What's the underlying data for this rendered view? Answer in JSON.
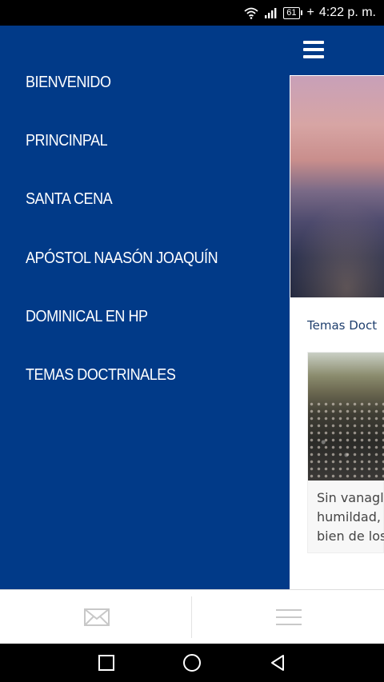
{
  "status_bar": {
    "battery": "61",
    "time": "4:22 p. m."
  },
  "drawer": {
    "items": [
      {
        "label": "BIENVENIDO"
      },
      {
        "label": "PRINCINPAL"
      },
      {
        "label": "SANTA CENA"
      },
      {
        "label": "APÓSTOL NAASÓN JOAQUÍN"
      },
      {
        "label": "DOMINICAL EN HP"
      },
      {
        "label": "TEMAS DOCTRINALES"
      }
    ]
  },
  "content": {
    "section_link": "Temas Doct",
    "card_text": "Sin vanaglo\nhumildad, n\nbien de los"
  },
  "icons": {
    "menu": "hamburger-icon",
    "mail": "mail-icon",
    "list": "list-icon",
    "wifi": "wifi-icon",
    "signal": "signal-icon",
    "battery": "battery-icon",
    "nav_recent": "square-icon",
    "nav_home": "circle-icon",
    "nav_back": "triangle-back-icon"
  },
  "colors": {
    "brand_blue": "#013a88",
    "link_text": "#1f3f6e"
  }
}
